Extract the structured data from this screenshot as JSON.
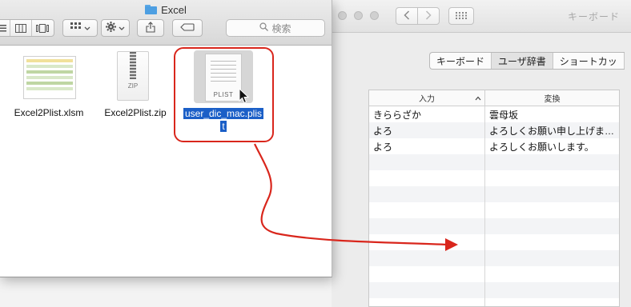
{
  "finder": {
    "title": "Excel",
    "search_placeholder": "検索",
    "files": [
      {
        "name": "Excel2Plist.xlsm",
        "icon": "xlsm-file-icon"
      },
      {
        "name": "Excel2Plist.zip",
        "icon": "zip-file-icon",
        "badge": "ZIP"
      },
      {
        "name_line1": "user_dic_mac.plis",
        "name_line2": "t",
        "icon": "plist-file-icon",
        "badge": "PLIST",
        "selected": true
      }
    ]
  },
  "prefs": {
    "title": "キーボード",
    "tabs": [
      "キーボード",
      "ユーザ辞書",
      "ショートカッ"
    ],
    "active_tab": "ユーザ辞書",
    "columns": {
      "input": "入力",
      "conversion": "変換"
    },
    "rows": [
      {
        "input": "きららざか",
        "conversion": "雲母坂"
      },
      {
        "input": "よろ",
        "conversion": "よろしくお願い申し上げま…"
      },
      {
        "input": "よろ",
        "conversion": "よろしくお願いします。"
      }
    ]
  },
  "colors": {
    "annotation": "#d9261c",
    "selection": "#1b5fc7"
  }
}
